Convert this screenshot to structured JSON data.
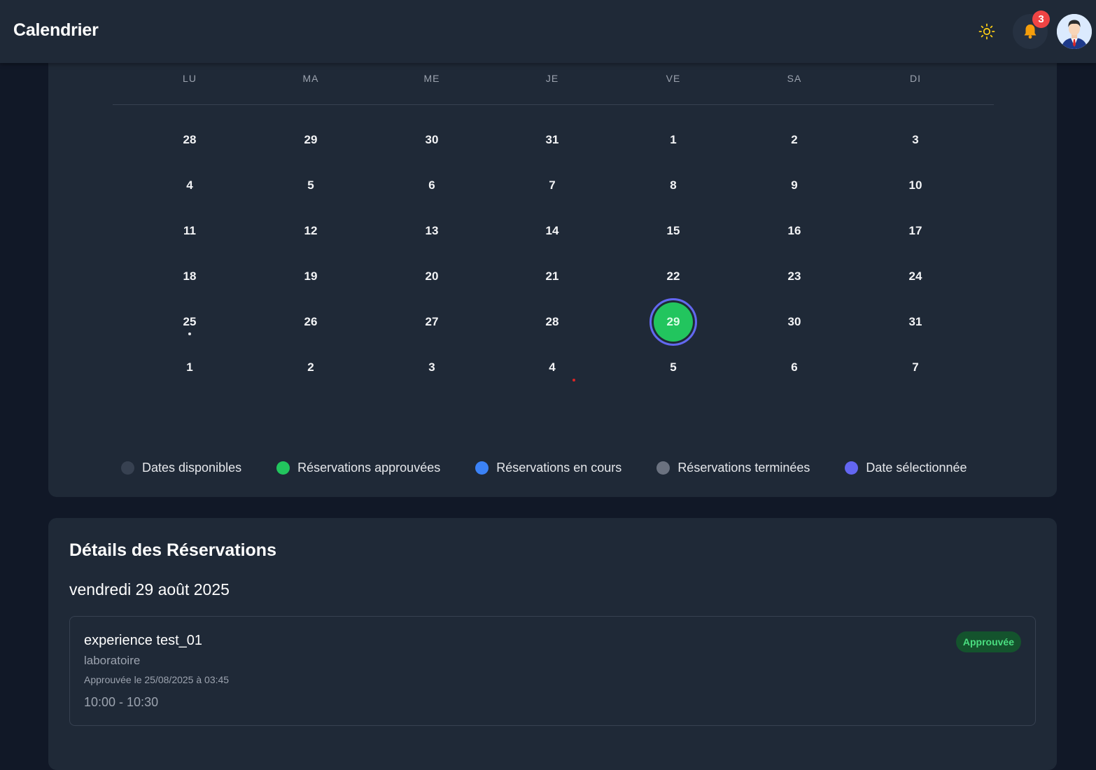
{
  "header": {
    "title": "Calendrier",
    "notification_count": "3"
  },
  "calendar": {
    "weekdays": [
      "LU",
      "MA",
      "ME",
      "JE",
      "VE",
      "SA",
      "DI"
    ],
    "weeks": [
      [
        "28",
        "29",
        "30",
        "31",
        "1",
        "2",
        "3"
      ],
      [
        "4",
        "5",
        "6",
        "7",
        "8",
        "9",
        "10"
      ],
      [
        "11",
        "12",
        "13",
        "14",
        "15",
        "16",
        "17"
      ],
      [
        "18",
        "19",
        "20",
        "21",
        "22",
        "23",
        "24"
      ],
      [
        "25",
        "26",
        "27",
        "28",
        "29",
        "30",
        "31"
      ],
      [
        "1",
        "2",
        "3",
        "4",
        "5",
        "6",
        "7"
      ]
    ],
    "selected_day": "29"
  },
  "legend": [
    {
      "label": "Dates disponibles",
      "color": "#374151"
    },
    {
      "label": "Réservations approuvées",
      "color": "#22c55e"
    },
    {
      "label": "Réservations en cours",
      "color": "#3b82f6"
    },
    {
      "label": "Réservations terminées",
      "color": "#6b7280"
    },
    {
      "label": "Date sélectionnée",
      "color": "#6366f1"
    }
  ],
  "details": {
    "title": "Détails des Réservations",
    "date": "vendredi 29 août 2025",
    "reservations": [
      {
        "name": "experience test_01",
        "place": "laboratoire",
        "approved_at": "Approuvée le 25/08/2025 à 03:45",
        "time": "10:00 - 10:30",
        "status": "Approuvée"
      }
    ]
  },
  "colors": {
    "accent": "#6366f1",
    "approved": "#22c55e",
    "badge": "#ef4444",
    "card": "#1f2937",
    "background": "#111827"
  }
}
